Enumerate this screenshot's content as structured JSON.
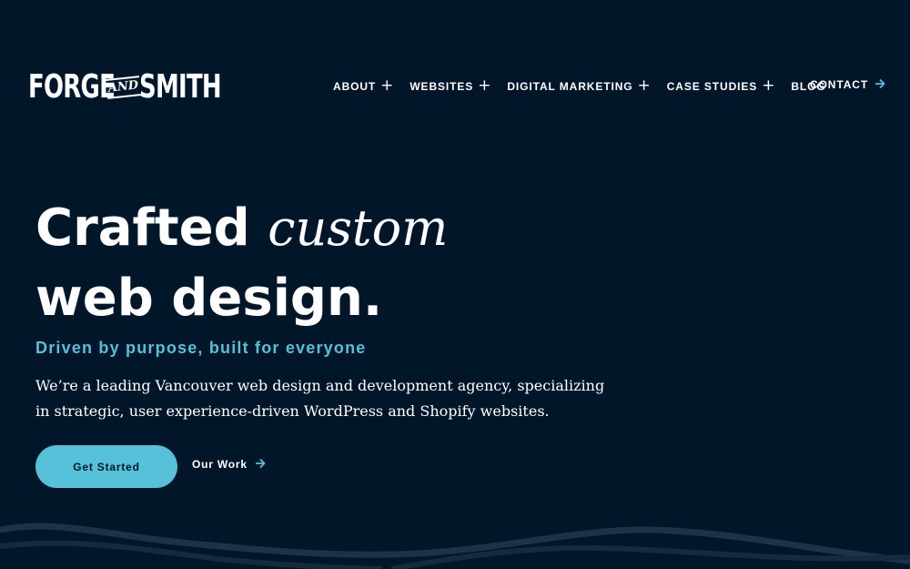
{
  "brand": {
    "logo_left": "FORGE",
    "logo_and": "AND",
    "logo_right": "SMITH"
  },
  "nav": {
    "items": [
      {
        "label": "ABOUT",
        "has_submenu": true
      },
      {
        "label": "WEBSITES",
        "has_submenu": true
      },
      {
        "label": "DIGITAL MARKETING",
        "has_submenu": true
      },
      {
        "label": "CASE STUDIES",
        "has_submenu": true
      },
      {
        "label": "BLOG",
        "has_submenu": false
      }
    ],
    "submenu_icon": "plus-icon",
    "contact_label": "CONTACT",
    "contact_icon": "arrow-right-icon"
  },
  "hero": {
    "title_line1_a": "Crafted",
    "title_line1_em": "custom",
    "title_line2": "web design.",
    "tagline": "Driven by purpose, built for everyone",
    "intro": "We’re a leading Vancouver web design and development agency, specializing in strategic, user experience-driven WordPress and Shopify websites.",
    "cta_primary": "Get Started",
    "cta_secondary": "Our Work",
    "cta_secondary_icon": "arrow-right-icon"
  },
  "colors": {
    "background": "#02162a",
    "accent": "#56c1d8",
    "text": "#ffffff",
    "wave": "#1b3247"
  }
}
